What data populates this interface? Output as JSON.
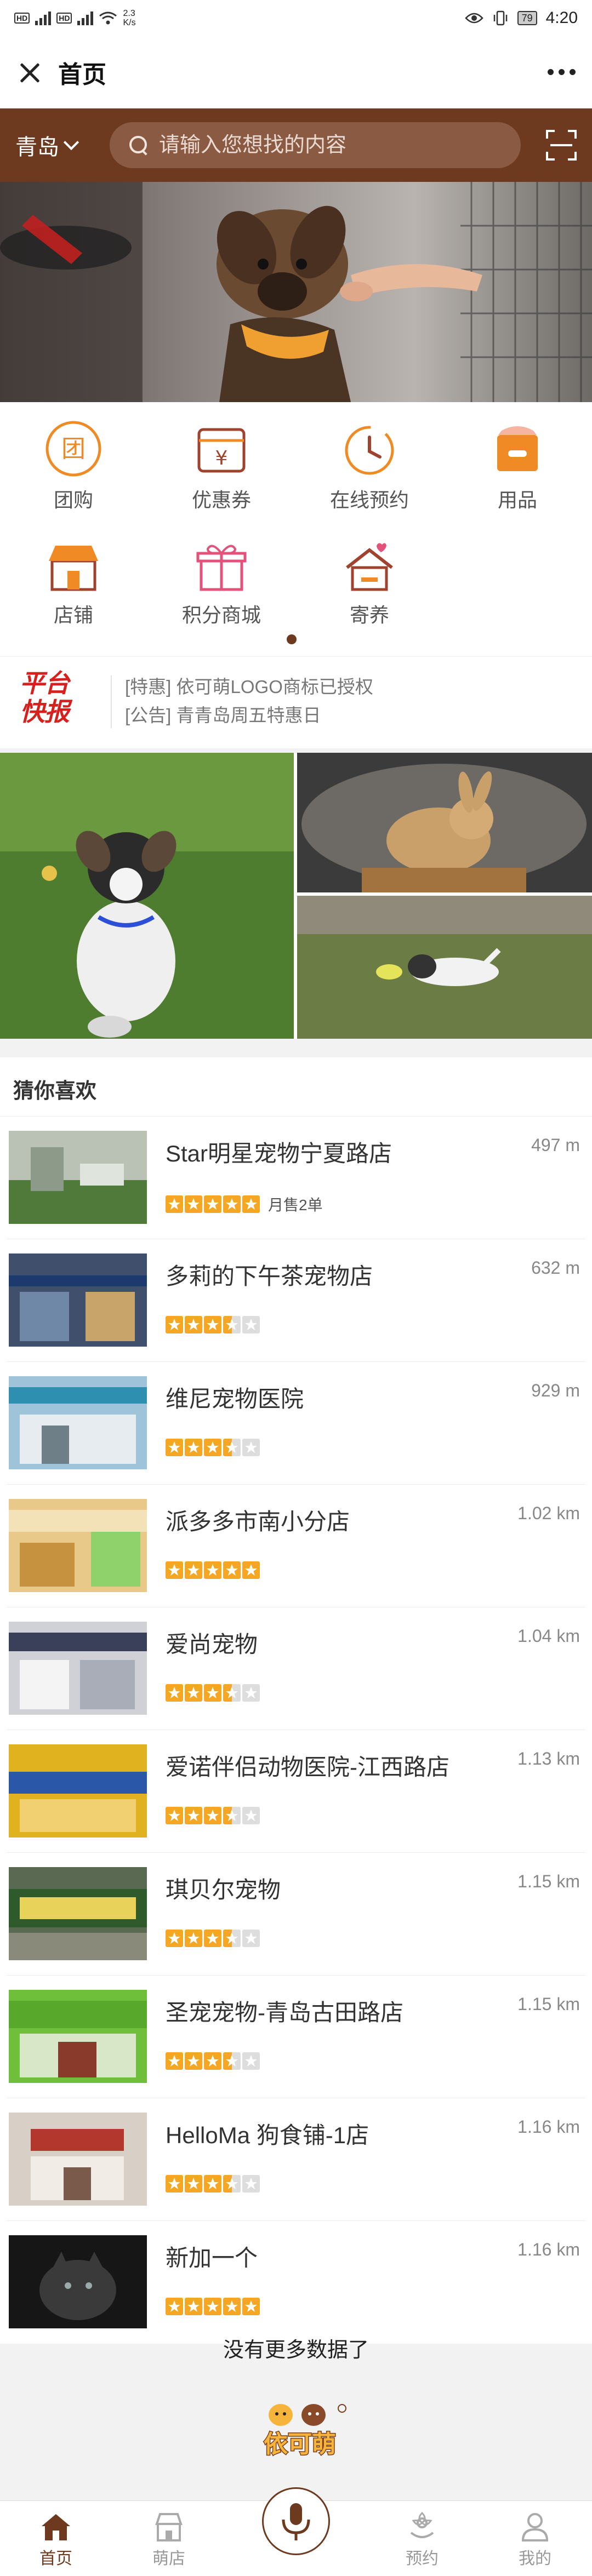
{
  "status_bar": {
    "speed_value": "2.3",
    "speed_unit": "K/s",
    "battery": "79",
    "time": "4:20"
  },
  "nav": {
    "title": "首页"
  },
  "search": {
    "city": "青岛",
    "placeholder": "请输入您想找的内容"
  },
  "categories": [
    {
      "label": "团购",
      "icon": "group-buy-icon",
      "glyph": "团"
    },
    {
      "label": "优惠券",
      "icon": "coupon-icon",
      "glyph": "¥"
    },
    {
      "label": "在线预约",
      "icon": "clock-icon"
    },
    {
      "label": "用品",
      "icon": "supplies-bag-icon"
    },
    {
      "label": "店铺",
      "icon": "store-icon"
    },
    {
      "label": "积分商城",
      "icon": "gift-icon"
    },
    {
      "label": "寄养",
      "icon": "foster-house-icon"
    }
  ],
  "news": {
    "logo_line1": "平台",
    "logo_line2": "快报",
    "items": [
      "[特惠] 依可萌LOGO商标已授权",
      "[公告] 青青岛周五特惠日"
    ]
  },
  "guess": {
    "title": "猜你喜欢",
    "items": [
      {
        "name": "Star明星宠物宁夏路店",
        "distance": "497 m",
        "rating": 5,
        "sold": "月售2单"
      },
      {
        "name": "多莉的下午茶宠物店",
        "distance": "632 m",
        "rating": 3.5
      },
      {
        "name": "维尼宠物医院",
        "distance": "929 m",
        "rating": 3.5
      },
      {
        "name": "派多多市南小分店",
        "distance": "1.02 km",
        "rating": 5
      },
      {
        "name": "爱尚宠物",
        "distance": "1.04 km",
        "rating": 3.5
      },
      {
        "name": "爱诺伴侣动物医院-江西路店",
        "distance": "1.13 km",
        "rating": 3.5
      },
      {
        "name": "琪贝尔宠物",
        "distance": "1.15 km",
        "rating": 3.5
      },
      {
        "name": "圣宠宠物-青岛古田路店",
        "distance": "1.15 km",
        "rating": 3.5
      },
      {
        "name": "HelloMa 狗食铺-1店",
        "distance": "1.16 km",
        "rating": 3.5
      },
      {
        "name": "新加一个",
        "distance": "1.16 km",
        "rating": 5
      }
    ]
  },
  "footer": {
    "no_more": "没有更多数据了",
    "brand_logo_text": "依可萌"
  },
  "tabs": [
    {
      "label": "首页",
      "icon": "home-icon",
      "active": true
    },
    {
      "label": "萌店",
      "icon": "shop-icon"
    },
    {
      "label": "",
      "icon": "microphone-icon"
    },
    {
      "label": "预约",
      "icon": "flower-icon"
    },
    {
      "label": "我的",
      "icon": "user-icon"
    }
  ],
  "colors": {
    "brand_brown": "#6e3a1f",
    "search_bg": "#8b5a43",
    "star": "#f5a623",
    "star_empty": "#dddddd",
    "news_red": "#d6201e"
  }
}
